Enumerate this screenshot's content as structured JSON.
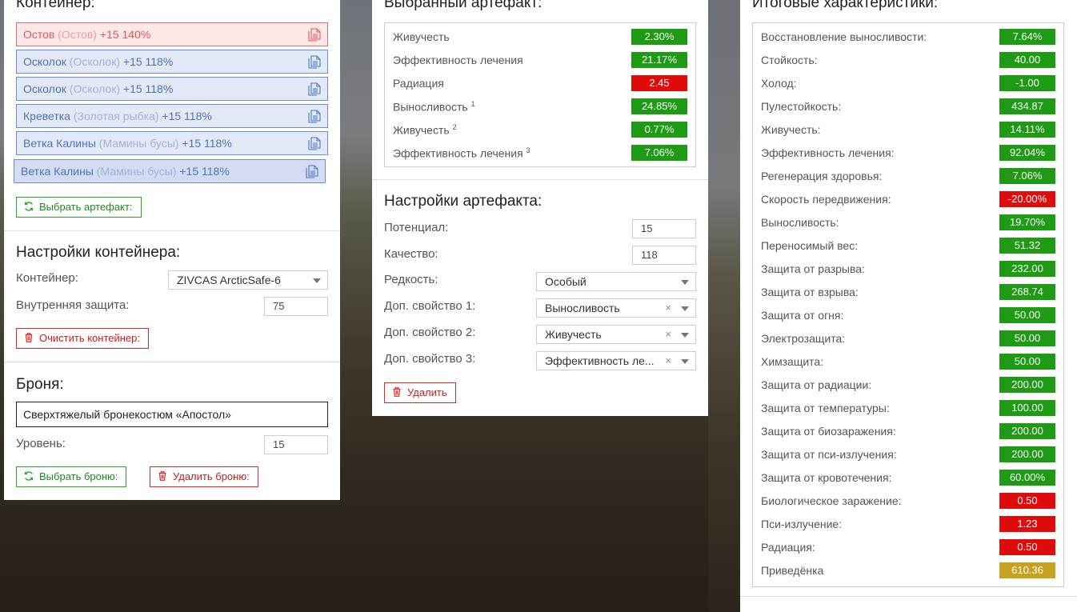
{
  "colors": {
    "good": "#1f9a14",
    "bad": "#e00c0c",
    "neutral": "#c6a21e"
  },
  "container": {
    "title": "Контейнер:",
    "items": [
      {
        "name": "Остов",
        "sub": "(Остов)",
        "bonus": "+15 140%",
        "style": "red"
      },
      {
        "name": "Осколок",
        "sub": "(Осколок)",
        "bonus": "+15 118%",
        "style": "blue"
      },
      {
        "name": "Осколок",
        "sub": "(Осколок)",
        "bonus": "+15 118%",
        "style": "blue"
      },
      {
        "name": "Креветка",
        "sub": "(Золотая рыбка)",
        "bonus": "+15 118%",
        "style": "blue"
      },
      {
        "name": "Ветка Калины",
        "sub": "(Мамины бусы)",
        "bonus": "+15 118%",
        "style": "blue"
      },
      {
        "name": "Ветка Калины",
        "sub": "(Мамины бусы)",
        "bonus": "+15 118%",
        "style": "blue"
      }
    ],
    "select_artifact_btn": "Выбрать артефакт:"
  },
  "container_settings": {
    "title": "Настройки контейнера:",
    "container_label": "Контейнер:",
    "container_value": "ZIVCAS ArcticSafe-6",
    "inner_protection_label": "Внутренняя защита:",
    "inner_protection_value": "75",
    "clear_btn": "Очистить контейнер:"
  },
  "armor": {
    "title": "Броня:",
    "name": "Сверхтяжелый бронекостюм «Апостол»",
    "level_label": "Уровень:",
    "level_value": "15",
    "select_btn": "Выбрать броню:",
    "delete_btn": "Удалить броню:"
  },
  "selected_artifact": {
    "title": "Выбранный артефакт:",
    "stats": [
      {
        "name": "Живучесть",
        "sup": "",
        "value": "2.30%",
        "status": "good"
      },
      {
        "name": "Эффективность лечения",
        "sup": "",
        "value": "21.17%",
        "status": "good"
      },
      {
        "name": "Радиация",
        "sup": "",
        "value": "2.45",
        "status": "bad"
      },
      {
        "name": "Выносливость",
        "sup": "1",
        "value": "24.85%",
        "status": "good"
      },
      {
        "name": "Живучесть",
        "sup": "2",
        "value": "0.77%",
        "status": "good"
      },
      {
        "name": "Эффективность лечения",
        "sup": "3",
        "value": "7.06%",
        "status": "good"
      }
    ]
  },
  "artifact_settings": {
    "title": "Настройки артефакта:",
    "potential_label": "Потенциал:",
    "potential_value": "15",
    "quality_label": "Качество:",
    "quality_value": "118",
    "rarity_label": "Редкость:",
    "rarity_value": "Особый",
    "prop1_label": "Доп. свойство 1:",
    "prop1_value": "Выносливость",
    "prop2_label": "Доп. свойство 2:",
    "prop2_value": "Живучесть",
    "prop3_label": "Доп. свойство 3:",
    "prop3_value": "Эффективность ле...",
    "clear_x": "×",
    "delete_btn": "Удалить"
  },
  "totals": {
    "title": "Итоговые характеристики:",
    "stats": [
      {
        "name": "Восстановление выносливости:",
        "value": "7.64%",
        "status": "good"
      },
      {
        "name": "Стойкость:",
        "value": "40.00",
        "status": "good"
      },
      {
        "name": "Холод:",
        "value": "-1.00",
        "status": "good"
      },
      {
        "name": "Пулестойкость:",
        "value": "434.87",
        "status": "good"
      },
      {
        "name": "Живучесть:",
        "value": "14.11%",
        "status": "good"
      },
      {
        "name": "Эффективность лечения:",
        "value": "92.04%",
        "status": "good"
      },
      {
        "name": "Регенерация здоровья:",
        "value": "7.06%",
        "status": "good"
      },
      {
        "name": "Скорость передвижения:",
        "value": "-20.00%",
        "status": "bad"
      },
      {
        "name": "Выносливость:",
        "value": "19.70%",
        "status": "good"
      },
      {
        "name": "Переносимый вес:",
        "value": "51.32",
        "status": "good"
      },
      {
        "name": "Защита от разрыва:",
        "value": "232.00",
        "status": "good"
      },
      {
        "name": "Защита от взрыва:",
        "value": "268.74",
        "status": "good"
      },
      {
        "name": "Защита от огня:",
        "value": "50.00",
        "status": "good"
      },
      {
        "name": "Электрозащита:",
        "value": "50.00",
        "status": "good"
      },
      {
        "name": "Химзащита:",
        "value": "50.00",
        "status": "good"
      },
      {
        "name": "Защита от радиации:",
        "value": "200.00",
        "status": "good"
      },
      {
        "name": "Защита от температуры:",
        "value": "100.00",
        "status": "good"
      },
      {
        "name": "Защита от биозаражения:",
        "value": "200.00",
        "status": "good"
      },
      {
        "name": "Защита от пси-излучения:",
        "value": "200.00",
        "status": "good"
      },
      {
        "name": "Защита от кровотечения:",
        "value": "60.00%",
        "status": "good"
      },
      {
        "name": "Биологическое заражение:",
        "value": "0.50",
        "status": "bad"
      },
      {
        "name": "Пси-излучение:",
        "value": "1.23",
        "status": "bad"
      },
      {
        "name": "Радиация:",
        "value": "0.50",
        "status": "bad"
      },
      {
        "name": "Приведёнка",
        "value": "610.36",
        "status": "neutral"
      }
    ]
  }
}
